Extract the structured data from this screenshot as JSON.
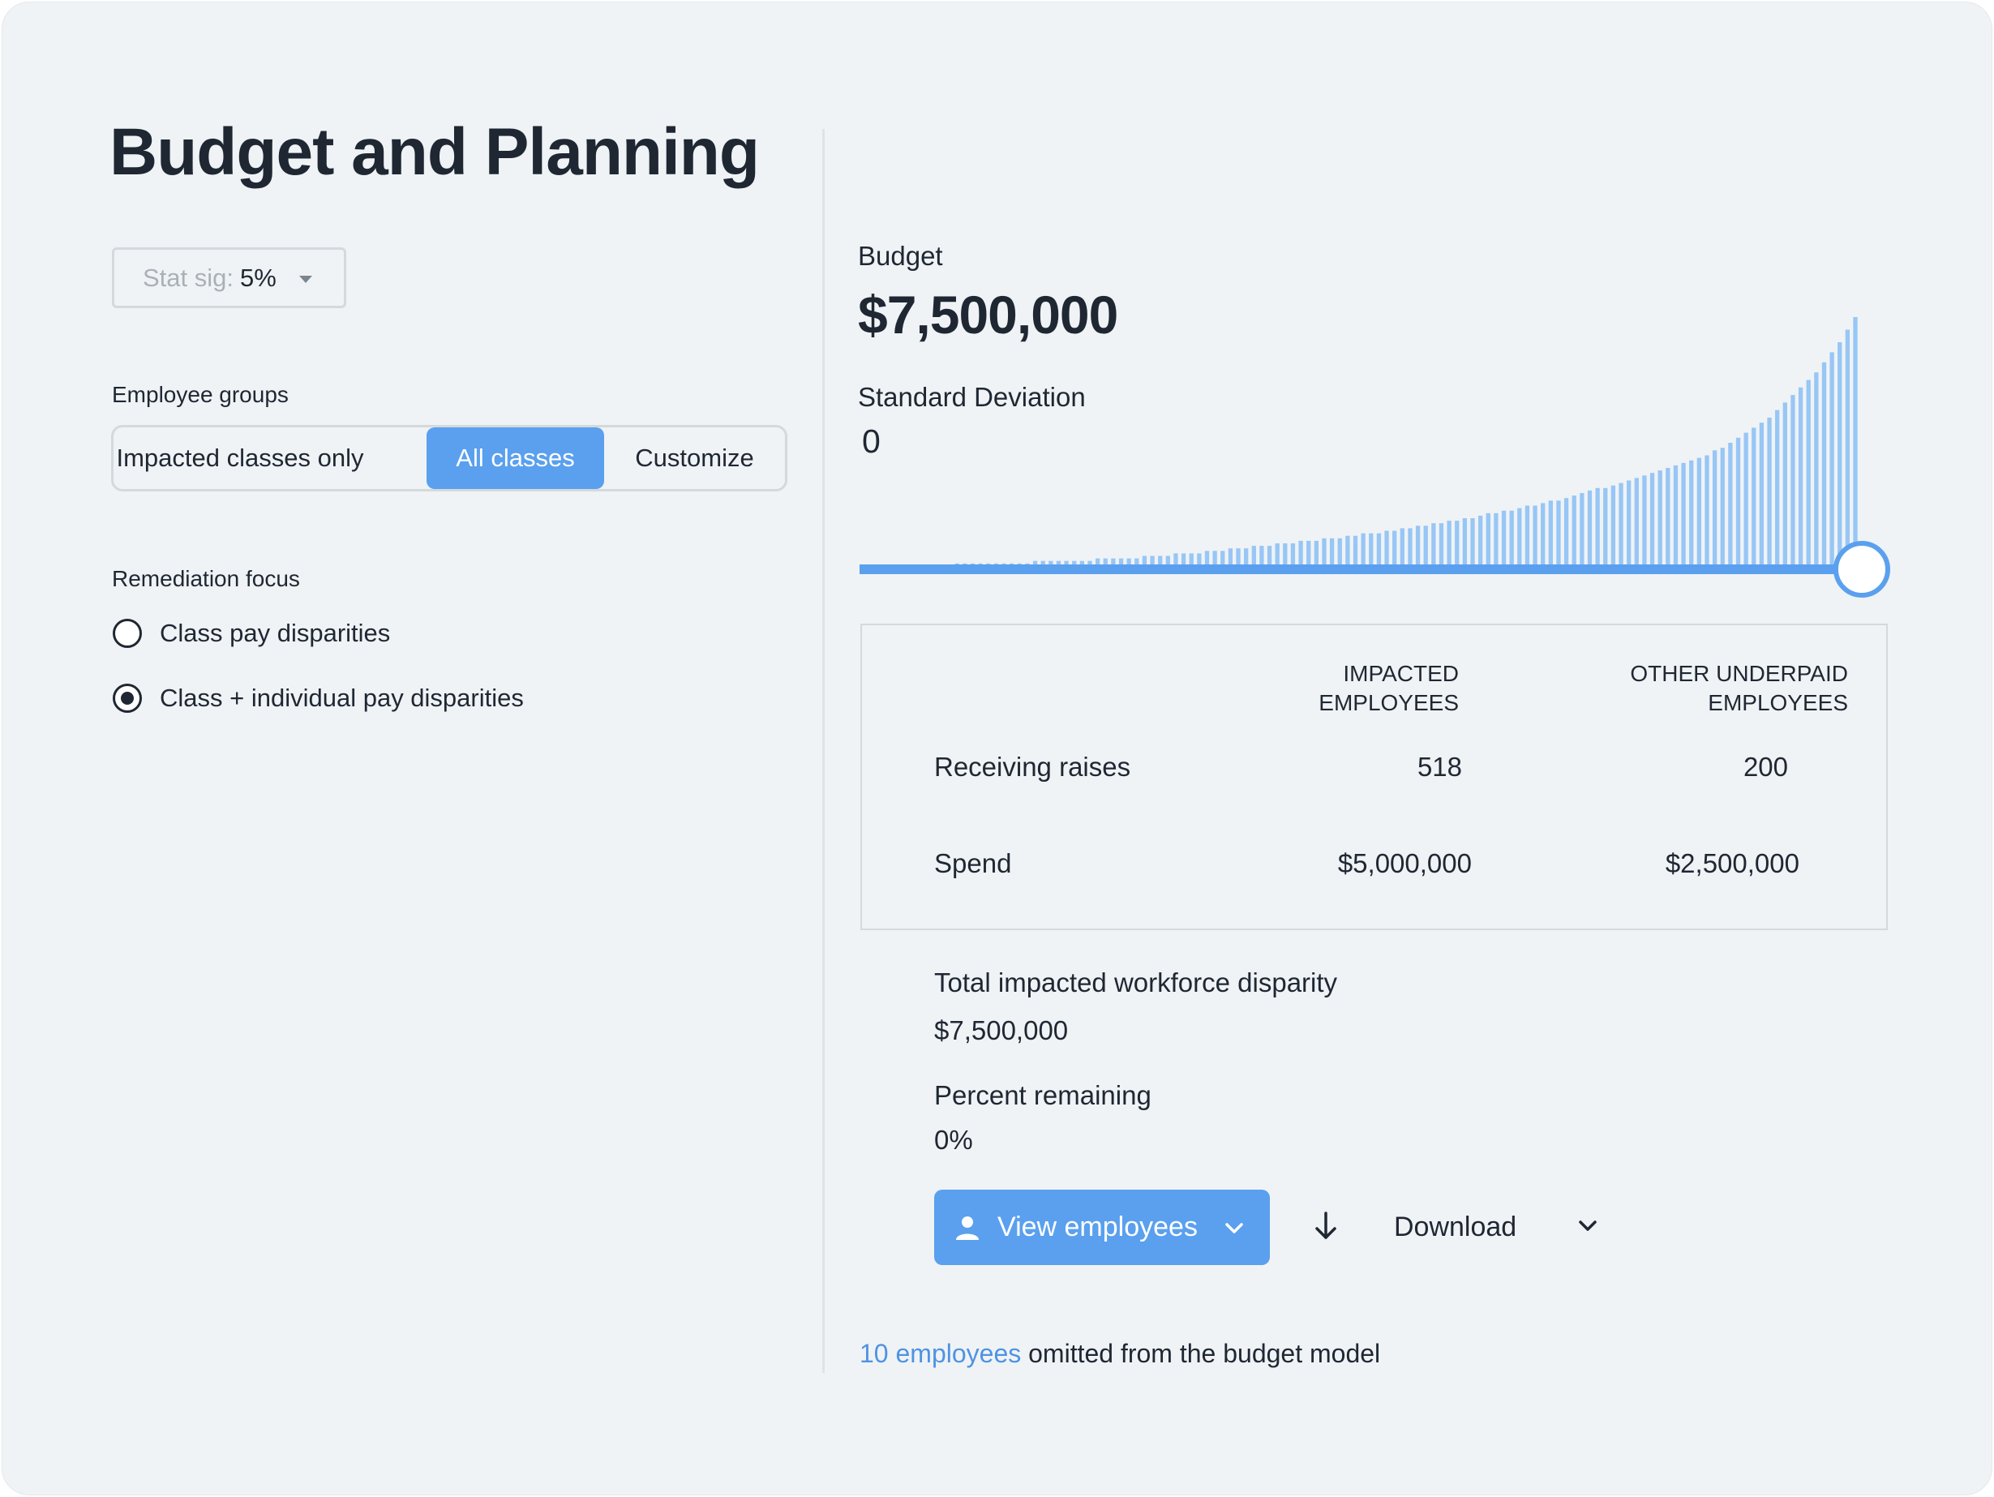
{
  "page": {
    "title": "Budget and Planning"
  },
  "stat_sig": {
    "label": "Stat sig:",
    "value": "5%"
  },
  "employee_groups": {
    "label": "Employee groups",
    "options": [
      "Impacted classes only",
      "All classes",
      "Customize"
    ],
    "selected": "All classes"
  },
  "remediation": {
    "label": "Remediation focus",
    "options": [
      "Class pay disparities",
      "Class + individual pay disparities"
    ],
    "selected": "Class + individual pay disparities"
  },
  "budget": {
    "label": "Budget",
    "value": "$7,500,000"
  },
  "std_dev": {
    "label": "Standard Deviation",
    "value": "0"
  },
  "slider": {
    "level": 1.0
  },
  "table": {
    "col1": [
      "IMPACTED",
      "EMPLOYEES"
    ],
    "col2": [
      "OTHER UNDERPAID",
      "EMPLOYEES"
    ],
    "rows": [
      {
        "label": "Receiving raises",
        "impacted": "518",
        "other": "200"
      },
      {
        "label": "Spend",
        "impacted": "$5,000,000",
        "other": "$2,500,000"
      }
    ]
  },
  "summary": {
    "disparity_label": "Total impacted workforce disparity",
    "disparity_value": "$7,500,000",
    "remaining_label": "Percent remaining",
    "remaining_value": "0%"
  },
  "actions": {
    "view_employees": "View employees",
    "download": "Download"
  },
  "footnote": {
    "link": "10 employees",
    "text": " omitted from the budget model"
  },
  "colors": {
    "accent": "#5aa0ee",
    "bar": "#98c6f5",
    "text": "#1f2733",
    "background": "#eff3f5"
  },
  "icons": [
    "chevron-down-icon",
    "person-icon",
    "download-arrow-icon"
  ],
  "chart_data": {
    "type": "bar",
    "values": [
      1,
      1,
      1,
      1,
      1,
      1,
      1,
      1,
      1,
      1,
      1,
      1,
      2,
      2,
      2,
      2,
      2,
      2,
      2,
      2,
      2,
      2,
      3,
      3,
      3,
      3,
      3,
      3,
      3,
      3,
      4,
      4,
      4,
      4,
      4,
      4,
      5,
      5,
      5,
      5,
      6,
      6,
      6,
      6,
      7,
      7,
      7,
      8,
      8,
      8,
      9,
      9,
      9,
      10,
      10,
      10,
      11,
      11,
      11,
      12,
      12,
      12,
      13,
      13,
      14,
      14,
      14,
      15,
      15,
      16,
      16,
      17,
      17,
      18,
      18,
      19,
      19,
      20,
      20,
      21,
      22,
      22,
      23,
      23,
      24,
      25,
      25,
      26,
      27,
      27,
      28,
      29,
      30,
      31,
      32,
      32,
      33,
      34,
      35,
      36,
      37,
      38,
      39,
      40,
      41,
      42,
      43,
      44,
      45,
      47,
      48,
      50,
      52,
      54,
      56,
      58,
      60,
      63,
      66,
      69,
      72,
      75,
      78,
      82,
      86,
      90,
      95,
      100
    ],
    "ylim": [
      0,
      100
    ]
  }
}
